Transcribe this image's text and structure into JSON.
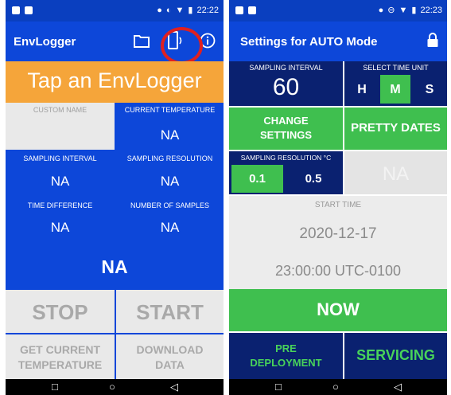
{
  "colors": {
    "blue": "#0d47d9",
    "dark_blue": "#0a2170",
    "green": "#3fbf4f",
    "grey": "#e9e9e9",
    "orange": "#f5a53a",
    "highlight": "#e02020"
  },
  "left": {
    "status_time": "22:22",
    "title": "EnvLogger",
    "icons": [
      "folder-icon",
      "phone-nfc-icon",
      "info-icon"
    ],
    "banner": "Tap an EnvLogger",
    "custom_name_label": "CUSTOM NAME",
    "current_temp_label": "CURRENT TEMPERATURE",
    "current_temp_value": "NA",
    "sampling_interval_label": "SAMPLING INTERVAL",
    "sampling_interval_value": "NA",
    "sampling_resolution_label": "SAMPLING RESOLUTION",
    "sampling_resolution_value": "NA",
    "time_difference_label": "TIME DIFFERENCE",
    "time_difference_value": "NA",
    "number_samples_label": "NUMBER OF SAMPLES",
    "number_samples_value": "NA",
    "status_value": "NA",
    "stop_label": "STOP",
    "start_label": "START",
    "get_temp_label_1": "GET CURRENT",
    "get_temp_label_2": "TEMPERATURE",
    "download_label_1": "DOWNLOAD",
    "download_label_2": "DATA"
  },
  "right": {
    "status_time": "22:23",
    "title": "Settings for AUTO Mode",
    "sampling_interval_label": "SAMPLING INTERVAL",
    "sampling_interval_value": "60",
    "time_unit_label": "SELECT TIME UNIT",
    "unit_h": "H",
    "unit_m": "M",
    "unit_s": "S",
    "selected_unit": "M",
    "change_settings_1": "CHANGE",
    "change_settings_2": "SETTINGS",
    "pretty_dates": "PRETTY DATES",
    "sampling_resolution_label": "SAMPLING RESOLUTION °C",
    "res_01": "0.1",
    "res_05": "0.5",
    "hidden_na": "NA",
    "start_time_label": "START TIME",
    "start_date": "2020-12-17",
    "start_time": "23:00:00 UTC-0100",
    "now_label": "NOW",
    "pre_deployment_1": "PRE",
    "pre_deployment_2": "DEPLOYMENT",
    "servicing_label": "SERVICING"
  }
}
